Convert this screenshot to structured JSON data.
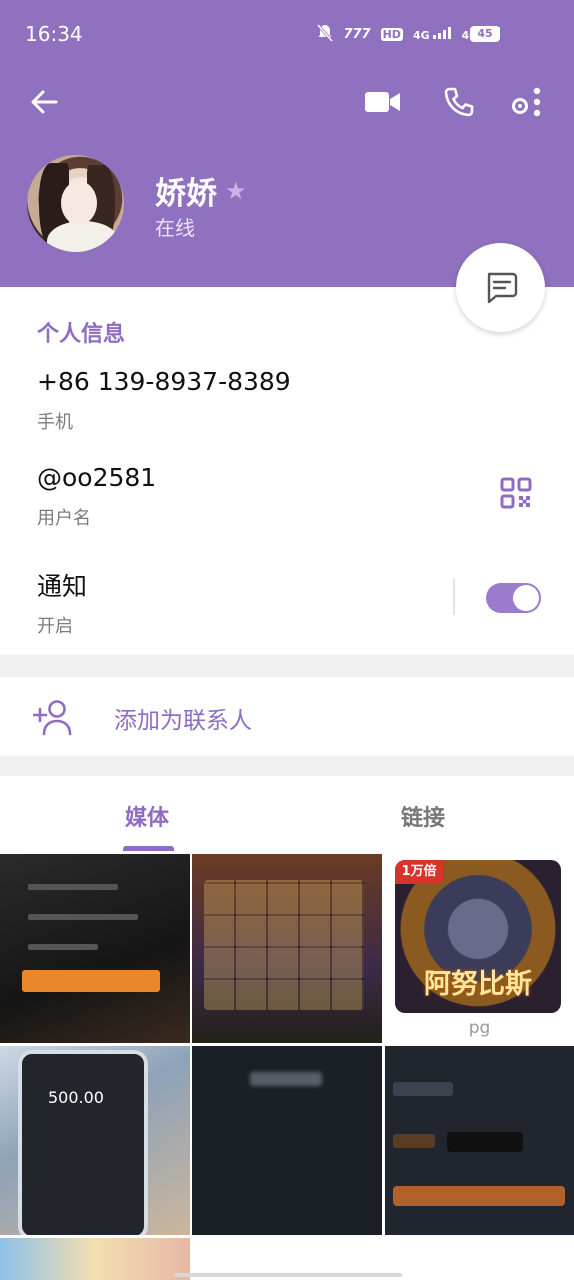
{
  "status_bar": {
    "time": "16:34",
    "network_1": "4G",
    "network_2": "4G",
    "hd": "HD",
    "battery": "45",
    "icons": [
      "mute-icon",
      "nfc-icon",
      "hd-icon",
      "signal-icon",
      "signal-icon",
      "battery-icon"
    ]
  },
  "header": {
    "name": "娇娇",
    "presence": "在线",
    "accent": "#8f71bf"
  },
  "info": {
    "title": "个人信息",
    "phone_value": "+86 139-8937-8389",
    "phone_label": "手机",
    "username_value": "@oo2581",
    "username_label": "用户名",
    "notify_value": "通知",
    "notify_label": "开启",
    "notify_enabled": true
  },
  "add_contact": {
    "label": "添加为联系人"
  },
  "tabs": [
    {
      "label": "媒体",
      "active": true
    },
    {
      "label": "链接",
      "active": false
    }
  ],
  "media": {
    "t3_badge": "1万倍",
    "t3_title": "阿努比斯",
    "t3_caption": "pg",
    "t4_amount": "500.00"
  }
}
